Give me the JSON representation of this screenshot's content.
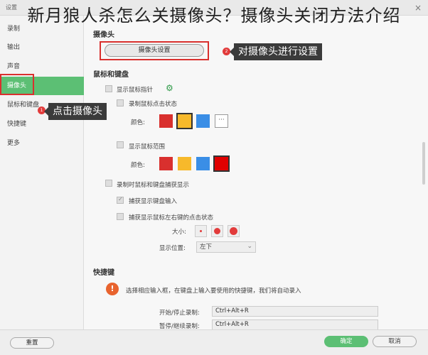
{
  "window": {
    "title": "设置",
    "close": "×"
  },
  "headline": "新月狼人杀怎么关摄像头？摄像头关闭方法介绍",
  "sidebar": {
    "items": [
      {
        "label": "录制"
      },
      {
        "label": "输出"
      },
      {
        "label": "声音"
      },
      {
        "label": "摄像头"
      },
      {
        "label": "鼠标和键盘"
      },
      {
        "label": "快捷键"
      },
      {
        "label": "更多"
      }
    ]
  },
  "camera": {
    "title": "摄像头",
    "button_label": "摄像头设置"
  },
  "callouts": {
    "camera_settings": {
      "badge": "2",
      "text": "对摄像头进行设置"
    },
    "click_camera": {
      "badge": "1",
      "text": "点击摄像头"
    }
  },
  "mouse": {
    "title": "鼠标和键盘",
    "show_pointer": "显示鼠标指针",
    "record_click": "录制鼠标点击状态",
    "color_label": "颜色:",
    "show_range": "显示鼠标范围",
    "color_label2": "颜色:",
    "record_display": "录制时鼠标和键盘捕获显示",
    "capture_keyboard": "捕获显示键盘输入",
    "capture_clicks": "捕获显示鼠标左右键的点击状态",
    "size_label": "大小:",
    "position_label": "显示位置:",
    "position_value": "左下",
    "colors1": [
      "#d9302e",
      "#f7b92b",
      "#3a8ee6"
    ],
    "colors2": [
      "#d9302e",
      "#f7b92b",
      "#3a8ee6",
      "#e00000"
    ],
    "more": "···"
  },
  "shortcuts": {
    "title": "快捷键",
    "info": "选择相应输入框，在键盘上输入要使用的快捷键，我们将自动录入",
    "start_stop_label": "开始/停止录制:",
    "start_stop_value": "Ctrl+Alt+R",
    "pause_label": "暂停/继续录制:",
    "pause_value": "Ctrl+Alt+R"
  },
  "footer": {
    "reset": "重置",
    "ok": "确定",
    "cancel": "取消"
  }
}
